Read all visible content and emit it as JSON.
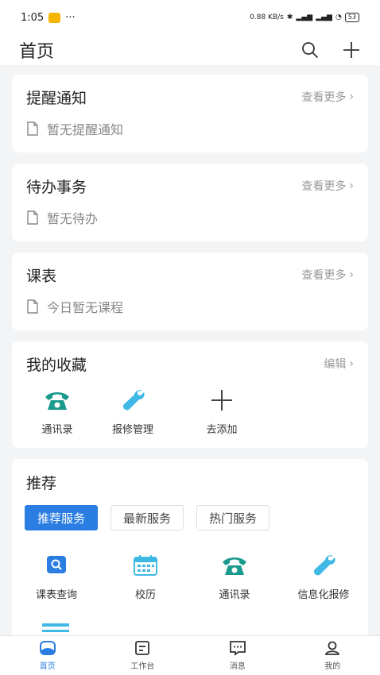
{
  "status_bar": {
    "time": "1:05",
    "dots": "···",
    "net_speed": "0.88 KB/s",
    "battery": "53"
  },
  "header": {
    "title": "首页"
  },
  "cards": {
    "reminder": {
      "title": "提醒通知",
      "more": "查看更多",
      "empty": "暂无提醒通知"
    },
    "todo": {
      "title": "待办事务",
      "more": "查看更多",
      "empty": "暂无待办"
    },
    "schedule": {
      "title": "课表",
      "more": "查看更多",
      "empty": "今日暂无课程"
    }
  },
  "favorites": {
    "title": "我的收藏",
    "edit": "编辑",
    "items": [
      {
        "label": "通讯录",
        "icon": "phone-icon"
      },
      {
        "label": "报修管理",
        "icon": "wrench-icon"
      },
      {
        "label": "去添加",
        "icon": "plus-icon"
      }
    ]
  },
  "recommend": {
    "title": "推荐",
    "tabs": [
      "推荐服务",
      "最新服务",
      "热门服务"
    ],
    "active_tab": 0,
    "items": [
      {
        "label": "课表查询",
        "icon": "search-icon"
      },
      {
        "label": "校历",
        "icon": "calendar-icon"
      },
      {
        "label": "通讯录",
        "icon": "phone-icon"
      },
      {
        "label": "信息化报修",
        "icon": "wrench-icon"
      }
    ]
  },
  "tabbar": [
    "首页",
    "工作台",
    "消息",
    "我的"
  ],
  "colors": {
    "primary": "#2a7de1",
    "phone": "#1a9a8c",
    "wrench": "#3fb8e6"
  }
}
